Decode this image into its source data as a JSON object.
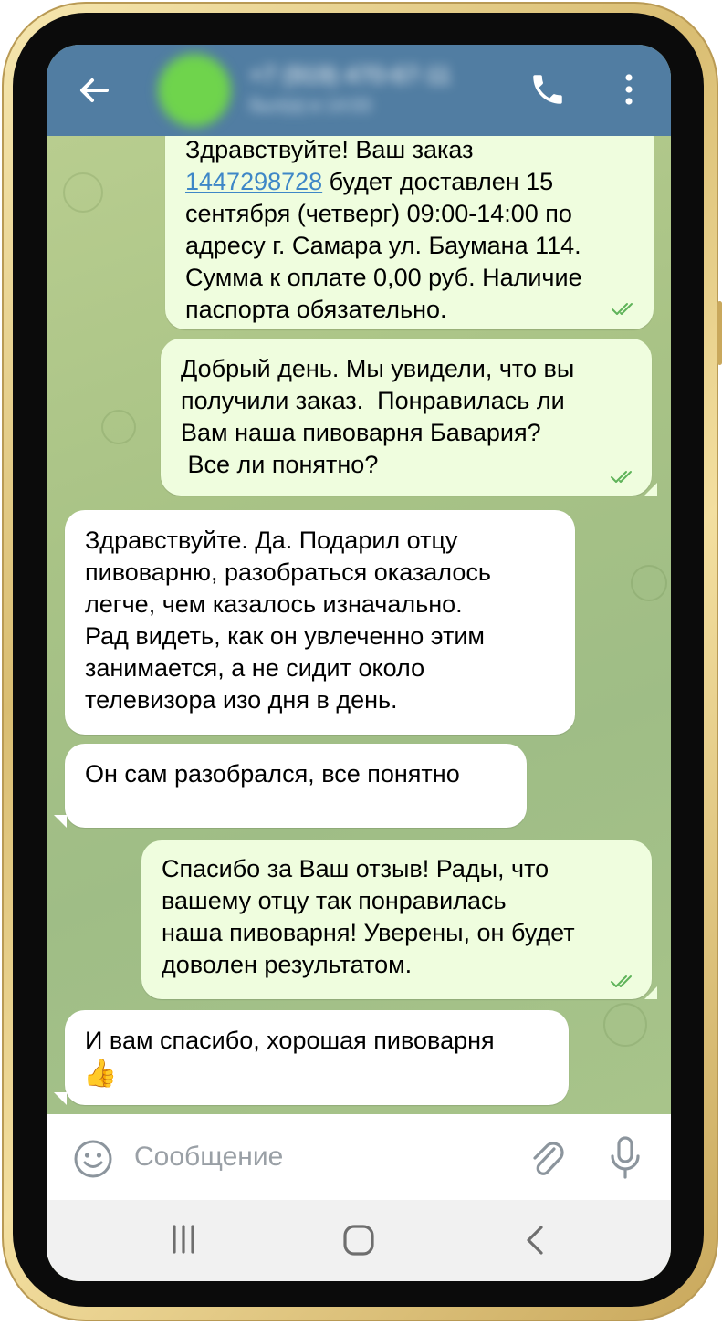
{
  "header": {
    "contact_name": "+7 (919) 470-67-11",
    "contact_status": "был(а) в 14:03"
  },
  "messages": [
    {
      "direction": "outgoing",
      "lines": [
        "Здравствуйте! Ваш заказ",
        "",
        "сентября (четверг) 09:00-14:00 по",
        "адресу г. Самара ул. Баумана 114.",
        "Сумма к оплате 0,00 руб. Наличие",
        "паспорта обязательно."
      ],
      "order_number": "1447298728",
      "after_link": " будет доставлен 15",
      "status": "read"
    },
    {
      "direction": "outgoing",
      "lines": [
        "Добрый день. Мы увидели, что вы",
        "получили заказ.  Понравилась ли",
        "Вам наша пивоварня Бавария?",
        " Все ли понятно?"
      ],
      "status": "read"
    },
    {
      "direction": "incoming",
      "lines": [
        "Здравствуйте. Да. Подарил отцу",
        "пивоварню, разобраться оказалось",
        "легче, чем казалось изначально.",
        "Рад видеть, как он увлеченно этим",
        "занимается, а не сидит около",
        "телевизора изо дня в день."
      ]
    },
    {
      "direction": "incoming",
      "lines": [
        "Он сам разобрался, все понятно"
      ]
    },
    {
      "direction": "outgoing",
      "lines": [
        "Спасибо за Ваш отзыв! Рады, что",
        "вашему отцу так понравилась",
        "наша пивоварня! Уверены, он будет",
        "доволен результатом."
      ],
      "status": "read"
    },
    {
      "direction": "incoming",
      "lines": [
        "И вам спасибо, хорошая пивоварня",
        "👍"
      ]
    }
  ],
  "composer": {
    "placeholder": "Сообщение"
  },
  "colors": {
    "header": "#517da2",
    "outgoing_bubble": "#effdde",
    "incoming_bubble": "#ffffff",
    "read_ticks": "#5fb35a",
    "link": "#3e87c7"
  },
  "icons": {
    "back": "arrow-left",
    "call": "phone",
    "menu": "three-dots-vertical",
    "emoji": "smiley",
    "attach": "paperclip",
    "voice": "microphone",
    "nav_recent": "three-bars",
    "nav_home": "rounded-square",
    "nav_back": "chevron-left"
  }
}
